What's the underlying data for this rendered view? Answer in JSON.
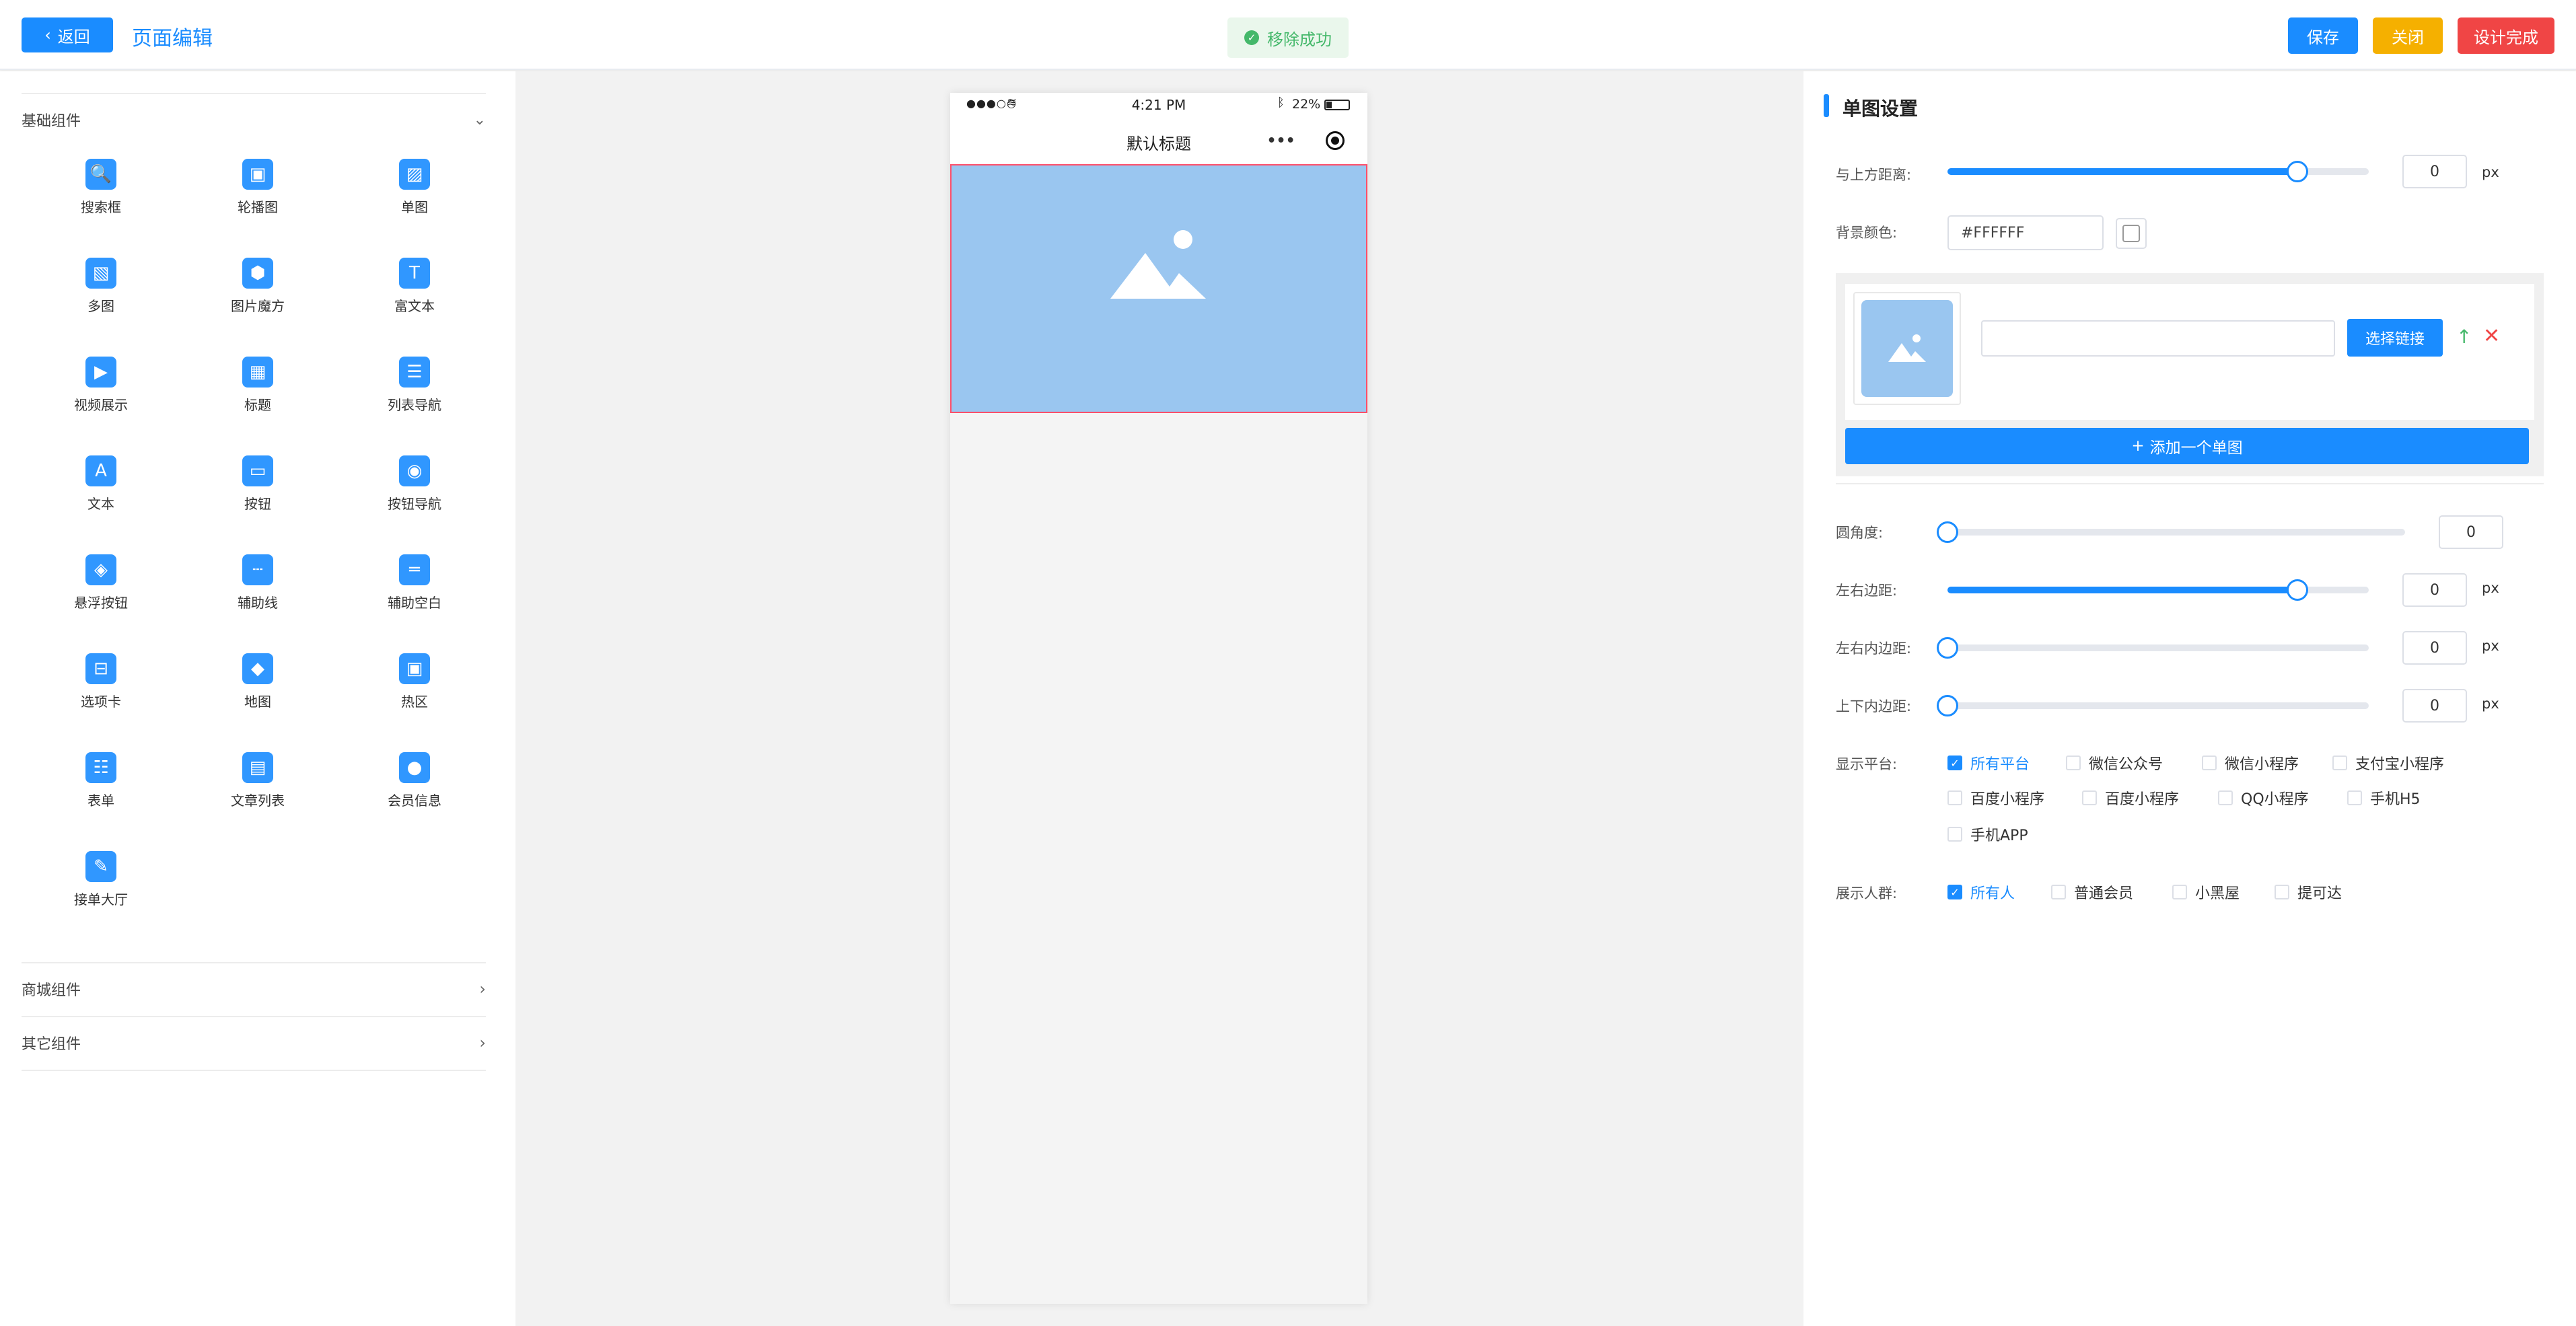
{
  "header": {
    "back_label": "返回",
    "title": "页面编辑",
    "toast": "移除成功",
    "save_label": "保存",
    "close_label": "关闭",
    "done_label": "设计完成"
  },
  "sidebar": {
    "basic_title": "基础组件",
    "components": [
      {
        "label": "搜索框",
        "icon": "search-box-icon"
      },
      {
        "label": "轮播图",
        "icon": "carousel-icon"
      },
      {
        "label": "单图",
        "icon": "single-image-icon"
      },
      {
        "label": "多图",
        "icon": "multi-image-icon"
      },
      {
        "label": "图片魔方",
        "icon": "image-cube-icon"
      },
      {
        "label": "富文本",
        "icon": "rich-text-icon"
      },
      {
        "label": "视频展示",
        "icon": "video-icon"
      },
      {
        "label": "标题",
        "icon": "title-icon"
      },
      {
        "label": "列表导航",
        "icon": "list-nav-icon"
      },
      {
        "label": "文本",
        "icon": "text-icon"
      },
      {
        "label": "按钮",
        "icon": "button-icon"
      },
      {
        "label": "按钮导航",
        "icon": "button-nav-icon"
      },
      {
        "label": "悬浮按钮",
        "icon": "float-button-icon"
      },
      {
        "label": "辅助线",
        "icon": "guide-line-icon"
      },
      {
        "label": "辅助空白",
        "icon": "blank-space-icon"
      },
      {
        "label": "选项卡",
        "icon": "tab-icon"
      },
      {
        "label": "地图",
        "icon": "map-icon"
      },
      {
        "label": "热区",
        "icon": "hotspot-icon"
      },
      {
        "label": "表单",
        "icon": "form-icon"
      },
      {
        "label": "文章列表",
        "icon": "article-list-icon"
      },
      {
        "label": "会员信息",
        "icon": "member-info-icon"
      },
      {
        "label": "接单大厅",
        "icon": "order-hall-icon"
      }
    ],
    "mall_title": "商城组件",
    "other_title": "其它组件"
  },
  "phone": {
    "signal": "●●●○○",
    "time": "4:21 PM",
    "battery": "22%",
    "page_title": "默认标题",
    "more_glyph": "•••"
  },
  "panel": {
    "title": "单图设置",
    "top_distance_label": "与上方距离:",
    "top_distance_value": "0",
    "top_distance_slider": 0.83,
    "bg_color_label": "背景颜色:",
    "bg_color_value": "#FFFFFF",
    "link_placeholder": "",
    "choose_link_label": "选择链接",
    "add_image_label": "添加一个单图",
    "radius_label": "圆角度:",
    "radius_value": "0",
    "radius_slider": 0.0,
    "lr_margin_label": "左右边距:",
    "lr_margin_value": "0",
    "lr_margin_slider": 0.83,
    "lr_padding_label": "左右内边距:",
    "lr_padding_value": "0",
    "lr_padding_slider": 0.0,
    "tb_padding_label": "上下内边距:",
    "tb_padding_value": "0",
    "tb_padding_slider": 0.0,
    "unit": "px",
    "platform_label": "显示平台:",
    "platforms": [
      {
        "label": "所有平台",
        "checked": true
      },
      {
        "label": "微信公众号",
        "checked": false
      },
      {
        "label": "微信小程序",
        "checked": false
      },
      {
        "label": "支付宝小程序",
        "checked": false
      },
      {
        "label": "百度小程序",
        "checked": false
      },
      {
        "label": "百度小程序",
        "checked": false
      },
      {
        "label": "QQ小程序",
        "checked": false
      },
      {
        "label": "手机H5",
        "checked": false
      },
      {
        "label": "手机APP",
        "checked": false
      }
    ],
    "audience_label": "展示人群:",
    "audiences": [
      {
        "label": "所有人",
        "checked": true
      },
      {
        "label": "普通会员",
        "checked": false
      },
      {
        "label": "小黑屋",
        "checked": false
      },
      {
        "label": "提可达",
        "checked": false
      }
    ]
  },
  "colors": {
    "accent": "#1a8cff",
    "warning": "#f5b000",
    "danger": "#f04545",
    "success": "#44b86a",
    "image_placeholder": "#9ac6f0"
  }
}
